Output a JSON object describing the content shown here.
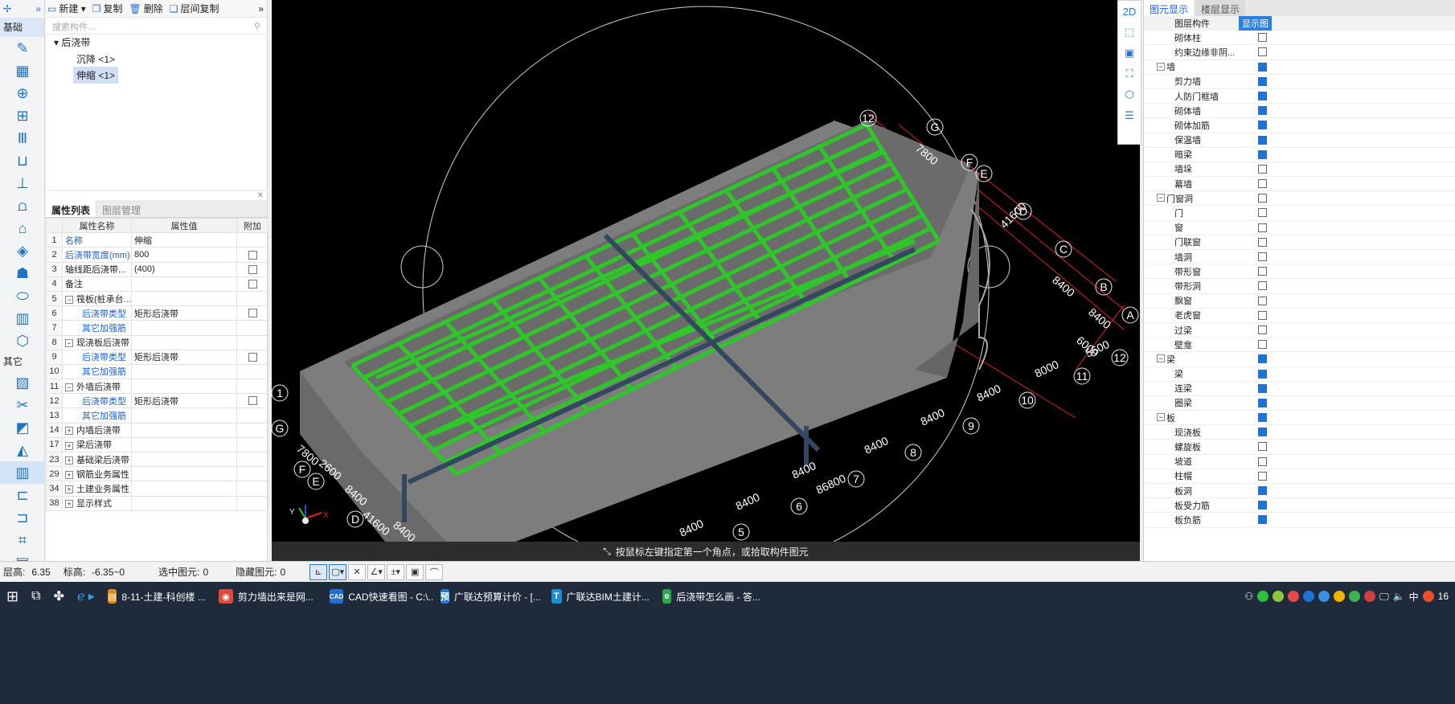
{
  "left_column": {
    "groups": [
      {
        "label": "基础"
      },
      {
        "label": "其它"
      }
    ],
    "top_icons": [
      "✢",
      "»"
    ]
  },
  "tree_toolbar": {
    "new_label": "新建",
    "copy_label": "复制",
    "delete_label": "删除",
    "floor_copy_label": "层间复制"
  },
  "search": {
    "placeholder": "搜索构件..."
  },
  "tree": {
    "root": "后浇带",
    "children": [
      {
        "label": "沉降 <1>"
      },
      {
        "label": "伸缩 <1>"
      }
    ]
  },
  "props_panel": {
    "tabs": [
      {
        "label": "属性列表"
      },
      {
        "label": "图层管理"
      }
    ],
    "headers": [
      "属性名称",
      "属性值",
      "附加"
    ],
    "rows": [
      {
        "n": "1",
        "name": "名称",
        "value": "伸缩",
        "blue": true
      },
      {
        "n": "2",
        "name": "后浇带宽度(mm)",
        "value": "800",
        "blue": true
      },
      {
        "n": "3",
        "name": "轴线距后浇带...",
        "value": "(400)"
      },
      {
        "n": "4",
        "name": "备注",
        "value": ""
      },
      {
        "n": "5",
        "name": "筏板(桩承台...",
        "value": ""
      },
      {
        "n": "6",
        "name": "后浇带类型",
        "value": "矩形后浇带",
        "blue": true
      },
      {
        "n": "7",
        "name": "其它加强筋",
        "value": "",
        "blue": true
      },
      {
        "n": "8",
        "name": "现浇板后浇带",
        "value": ""
      },
      {
        "n": "9",
        "name": "后浇带类型",
        "value": "矩形后浇带",
        "blue": true
      },
      {
        "n": "10",
        "name": "其它加强筋",
        "value": "",
        "blue": true
      },
      {
        "n": "11",
        "name": "外墙后浇带",
        "value": ""
      },
      {
        "n": "12",
        "name": "后浇带类型",
        "value": "矩形后浇带",
        "blue": true
      },
      {
        "n": "13",
        "name": "其它加强筋",
        "value": "",
        "blue": true
      },
      {
        "n": "14",
        "name": "内墙后浇带",
        "value": ""
      },
      {
        "n": "17",
        "name": "梁后浇带",
        "value": ""
      },
      {
        "n": "23",
        "name": "基础梁后浇带",
        "value": ""
      },
      {
        "n": "29",
        "name": "钢筋业务属性",
        "value": ""
      },
      {
        "n": "34",
        "name": "土建业务属性",
        "value": ""
      },
      {
        "n": "38",
        "name": "显示样式",
        "value": ""
      }
    ]
  },
  "viewport": {
    "hint": "按鼠标左键指定第一个角点，或拾取构件图元",
    "axis_labels_right": [
      "12",
      "G",
      "F",
      "E",
      "D",
      "C",
      "B",
      "A",
      "12",
      "11",
      "10",
      "9",
      "8",
      "7",
      "6",
      "5"
    ],
    "axis_labels_left": [
      "1",
      "G",
      "F",
      "E",
      "D"
    ],
    "dims": [
      "7800",
      "41600",
      "8400",
      "8400",
      "6000",
      "5600",
      "8000",
      "8400",
      "8400",
      "8400",
      "8400",
      "86800",
      "8400",
      "8400",
      "7800",
      "2600",
      "8400",
      "41600",
      "8400"
    ]
  },
  "right_panel": {
    "tabs": [
      {
        "label": "图元显示"
      },
      {
        "label": "楼层显示"
      }
    ],
    "header": {
      "col1": "图层构件",
      "col2": "显示图"
    },
    "rows": [
      {
        "label": "砌体柱",
        "group": false,
        "on": false
      },
      {
        "label": "约束边缘非阴...",
        "group": false,
        "on": false
      },
      {
        "label": "墙",
        "group": true,
        "on": true
      },
      {
        "label": "剪力墙",
        "group": false,
        "on": true
      },
      {
        "label": "人防门框墙",
        "group": false,
        "on": true
      },
      {
        "label": "砌体墙",
        "group": false,
        "on": true
      },
      {
        "label": "砌体加筋",
        "group": false,
        "on": true
      },
      {
        "label": "保温墙",
        "group": false,
        "on": true
      },
      {
        "label": "暗梁",
        "group": false,
        "on": true
      },
      {
        "label": "墙垛",
        "group": false,
        "on": false
      },
      {
        "label": "幕墙",
        "group": false,
        "on": false
      },
      {
        "label": "门窗洞",
        "group": true,
        "on": false
      },
      {
        "label": "门",
        "group": false,
        "on": false
      },
      {
        "label": "窗",
        "group": false,
        "on": false
      },
      {
        "label": "门联窗",
        "group": false,
        "on": false
      },
      {
        "label": "墙洞",
        "group": false,
        "on": false
      },
      {
        "label": "带形窗",
        "group": false,
        "on": false
      },
      {
        "label": "带形洞",
        "group": false,
        "on": false
      },
      {
        "label": "飘窗",
        "group": false,
        "on": false
      },
      {
        "label": "老虎窗",
        "group": false,
        "on": false
      },
      {
        "label": "过梁",
        "group": false,
        "on": false
      },
      {
        "label": "壁龛",
        "group": false,
        "on": false
      },
      {
        "label": "梁",
        "group": true,
        "on": true
      },
      {
        "label": "梁",
        "group": false,
        "on": true
      },
      {
        "label": "连梁",
        "group": false,
        "on": true
      },
      {
        "label": "圈梁",
        "group": false,
        "on": true
      },
      {
        "label": "板",
        "group": true,
        "on": true
      },
      {
        "label": "现浇板",
        "group": false,
        "on": true
      },
      {
        "label": "螺旋板",
        "group": false,
        "on": false
      },
      {
        "label": "坡道",
        "group": false,
        "on": false
      },
      {
        "label": "柱帽",
        "group": false,
        "on": false
      },
      {
        "label": "板洞",
        "group": false,
        "on": true
      },
      {
        "label": "板受力筋",
        "group": false,
        "on": true
      },
      {
        "label": "板负筋",
        "group": false,
        "on": true
      }
    ]
  },
  "status": {
    "floor_height": "层高:",
    "floor_height_val": "6.35",
    "elevation": "标高:",
    "elevation_val": "-6.35~0",
    "selected": "选中图元:",
    "selected_val": "0",
    "hidden": "隐藏图元:",
    "hidden_val": "0"
  },
  "taskbar": {
    "items": [
      {
        "label": "8-11-土建-科创楼 ...",
        "color": "#d98c1a",
        "icon": "▤"
      },
      {
        "label": "剪力墙出来是网...",
        "color": "#e04a3a",
        "icon": "◉"
      },
      {
        "label": "CAD快速看图 - C:\\...",
        "color": "#1f6fd1",
        "icon": "CAD"
      },
      {
        "label": "广联达预算计价 - [...",
        "color": "#2a78d6",
        "icon": "预"
      },
      {
        "label": "广联达BIM土建计...",
        "color": "#1a8fd8",
        "icon": "T"
      },
      {
        "label": "后浇带怎么画 - 答...",
        "color": "#2fa84a",
        "icon": "e"
      }
    ],
    "tray_lang": "中",
    "clock": "16"
  }
}
